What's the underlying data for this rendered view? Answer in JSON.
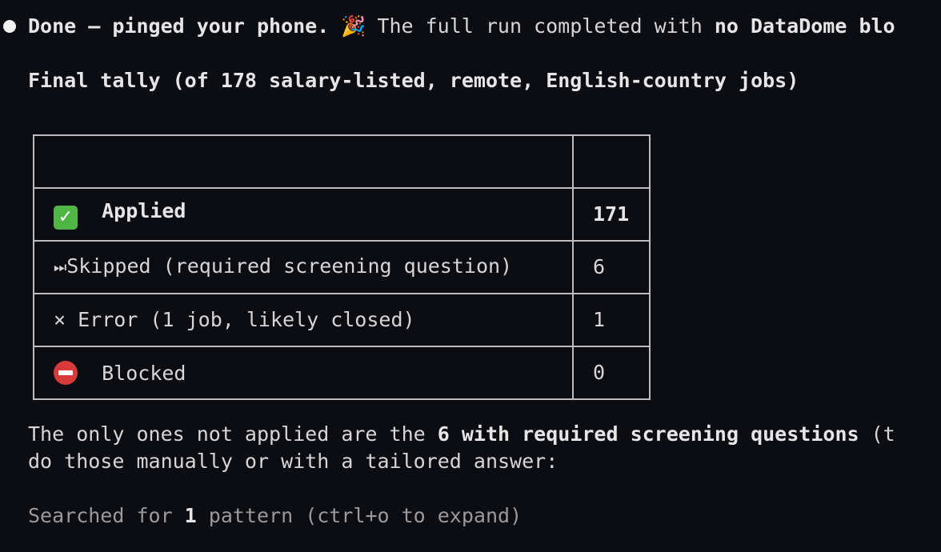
{
  "message": {
    "part1": "Done — pinged your phone. ",
    "party_icon": "party-popper-icon",
    "part2": " The full run completed with ",
    "part3": "no DataDome blo"
  },
  "tally": {
    "heading": "Final tally (of 178 salary-listed, remote, English-country jobs)",
    "rows": [
      {
        "icon": "check-mark-icon",
        "label": "Applied",
        "value": "171"
      },
      {
        "icon": "fast-forward-icon",
        "label": "Skipped (required screening question)",
        "value": "6"
      },
      {
        "icon": "cross-icon",
        "label": "Error (1 job, likely closed)",
        "value": "1"
      },
      {
        "icon": "no-entry-icon",
        "label": "Blocked",
        "value": "0"
      }
    ]
  },
  "note": {
    "part1": "The only ones not applied are the ",
    "part2": "6 with required screening questions",
    "part3": " (t",
    "line2": "do those manually or with a tailored answer:"
  },
  "search": {
    "part1": "Searched for ",
    "count": "1",
    "part2": " pattern (ctrl+o to expand)"
  }
}
